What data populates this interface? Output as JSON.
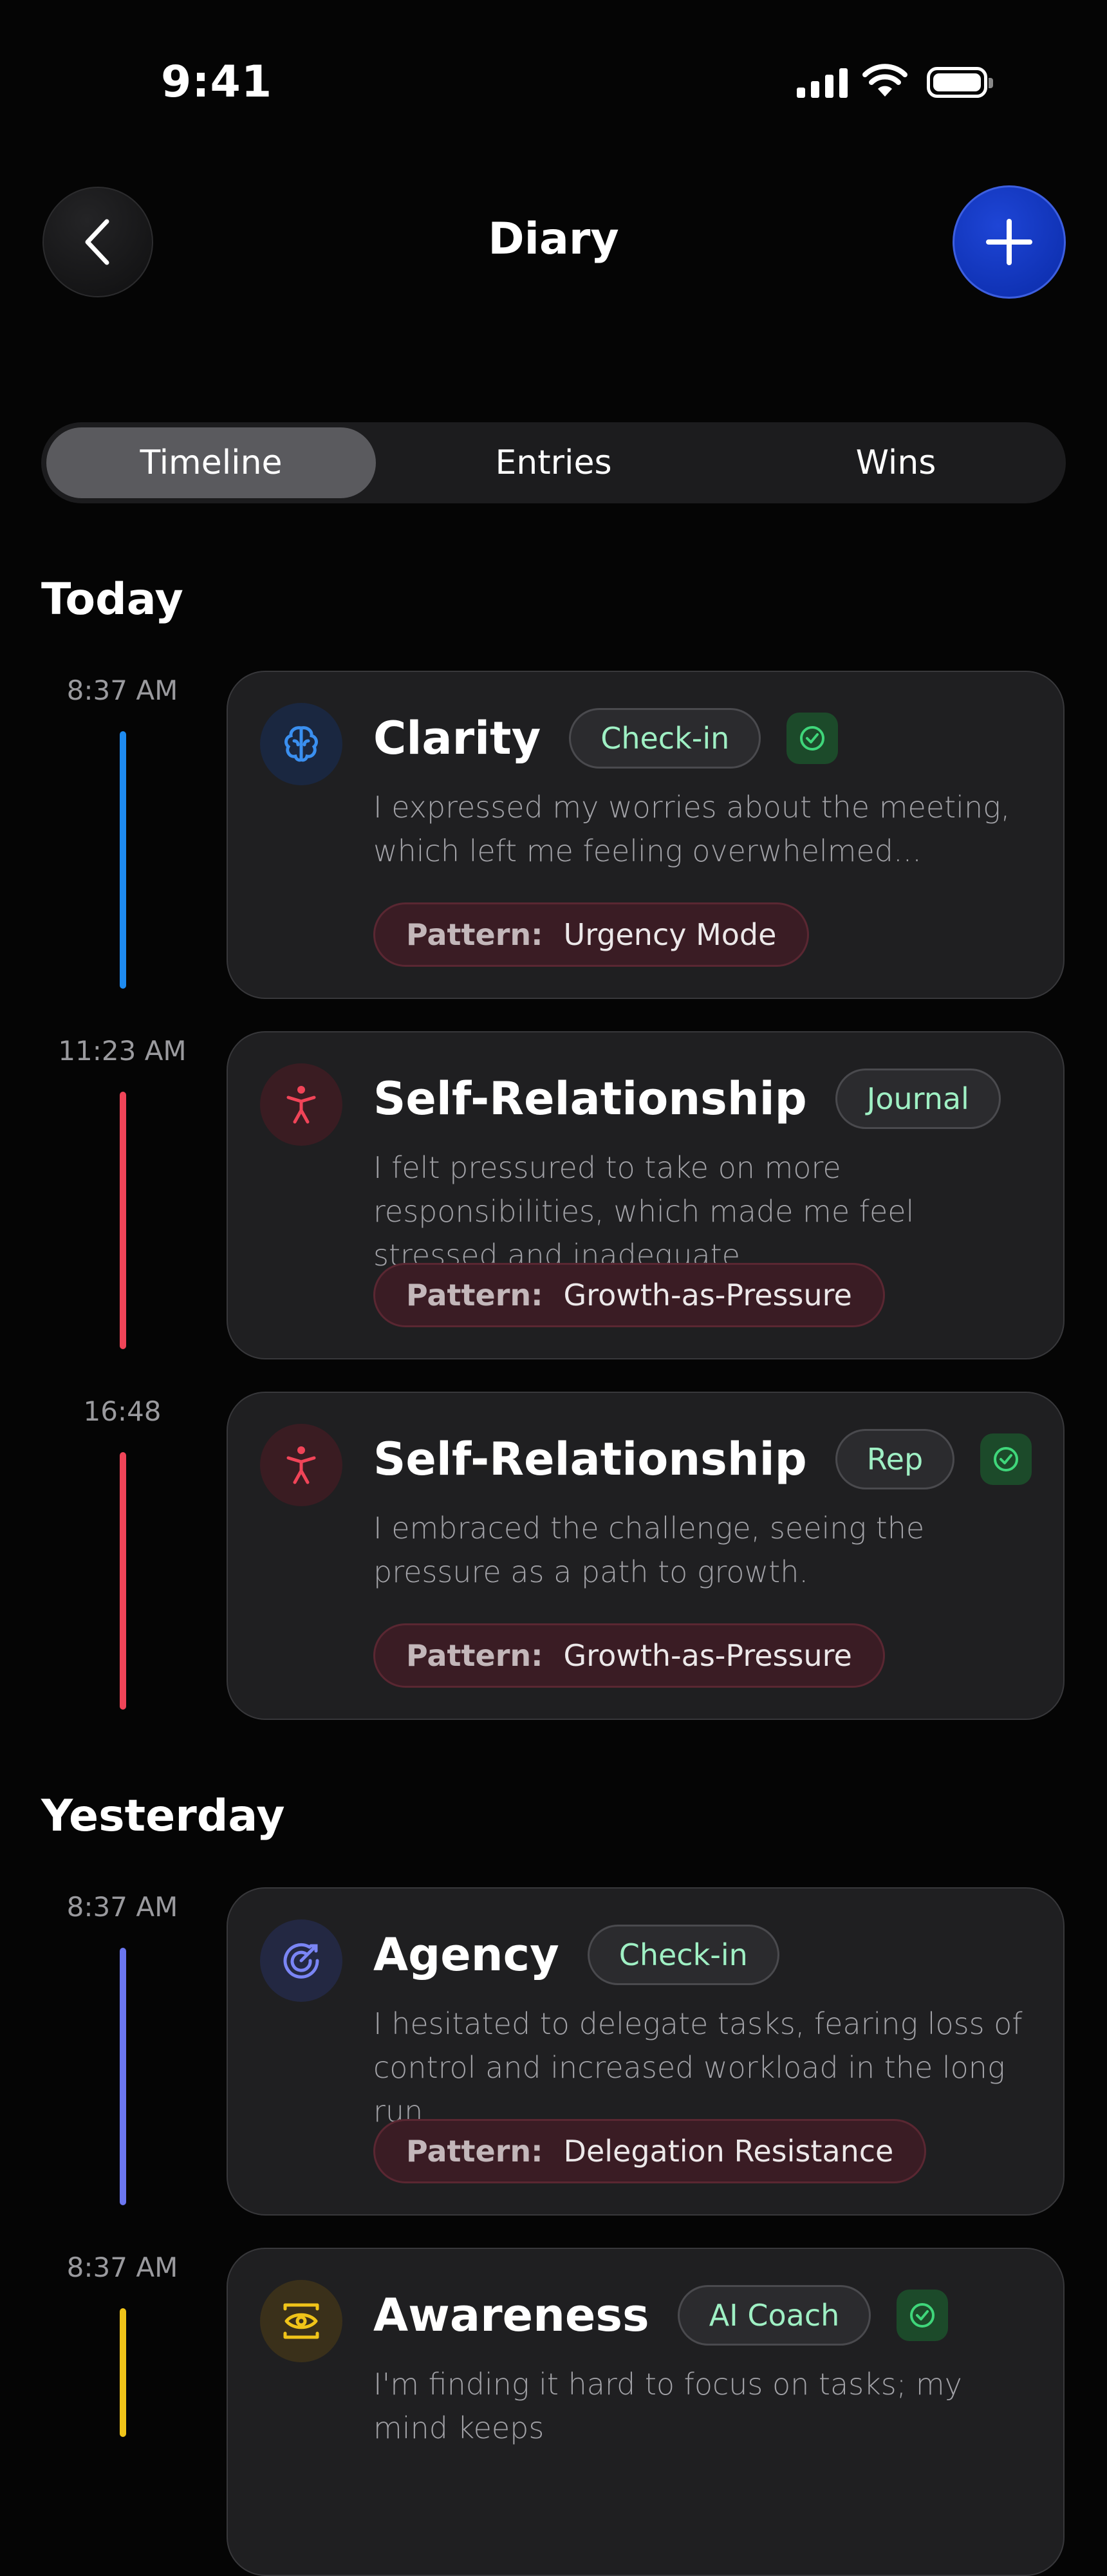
{
  "status_bar": {
    "time": "9:41"
  },
  "header": {
    "title": "Diary"
  },
  "tabs": [
    {
      "label": "Timeline",
      "active": true
    },
    {
      "label": "Entries",
      "active": false
    },
    {
      "label": "Wins",
      "active": false
    }
  ],
  "sections": {
    "today": "Today",
    "yesterday": "Yesterday"
  },
  "pattern_prefix": "Pattern:",
  "entries": [
    {
      "time": "8:37 AM",
      "category": "Clarity",
      "icon": "brain-icon",
      "accent_color": "#1e8bf0",
      "badge": "Check-in",
      "verified": true,
      "text": "I expressed my worries about the meeting, which left me feeling overwhelmed...",
      "pattern": "Urgency Mode"
    },
    {
      "time": "11:23 AM",
      "category": "Self-Relationship",
      "icon": "person-icon",
      "accent_color": "#f04458",
      "badge": "Journal",
      "verified": false,
      "text": "I felt pressured to take on more responsibilities, which made me feel stressed and inadequate.",
      "pattern": "Growth-as-Pressure"
    },
    {
      "time": "16:48",
      "category": "Self-Relationship",
      "icon": "person-icon",
      "accent_color": "#f04458",
      "badge": "Rep",
      "verified": true,
      "text": "I embraced the challenge, seeing the pressure as a path to growth.",
      "pattern": "Growth-as-Pressure"
    },
    {
      "time": "8:37 AM",
      "category": "Agency",
      "icon": "target-icon",
      "accent_color": "#6b76f0",
      "badge": "Check-in",
      "verified": false,
      "text": "I hesitated to delegate tasks, fearing loss of control and increased workload in the long run.",
      "pattern": "Delegation Resistance"
    },
    {
      "time": "8:37 AM",
      "category": "Awareness",
      "icon": "eye-icon",
      "accent_color": "#f0c419",
      "badge": "AI Coach",
      "verified": true,
      "text": "I'm finding it hard to focus on tasks; my mind keeps",
      "pattern": ""
    }
  ]
}
